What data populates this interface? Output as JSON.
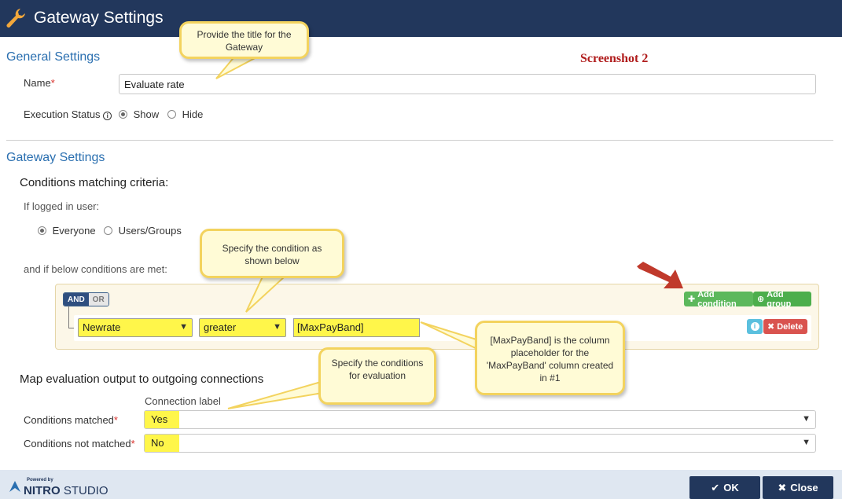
{
  "window": {
    "title": "Gateway Settings",
    "icon": "wrench-icon"
  },
  "annotation_label": "Screenshot 2",
  "general": {
    "section_title": "General Settings",
    "name_label": "Name",
    "name_value": "Evaluate rate",
    "execution_status_label": "Execution Status",
    "execution_options": [
      "Show",
      "Hide"
    ],
    "execution_selected": "Show"
  },
  "gateway": {
    "section_title": "Gateway Settings",
    "criteria_title": "Conditions matching criteria:",
    "logged_in_label": "If logged in user:",
    "user_options": [
      "Everyone",
      "Users/Groups"
    ],
    "user_selected": "Everyone",
    "conditions_met_label": "and if below conditions are met:",
    "logic": {
      "and": "AND",
      "or": "OR",
      "selected": "AND"
    },
    "add_condition": "Add condition",
    "add_group": "Add group",
    "rule": {
      "field": "Newrate",
      "operator": "greater",
      "value": "[MaxPayBand]"
    },
    "delete_label": "Delete"
  },
  "mapping": {
    "title": "Map evaluation output to outgoing connections",
    "connection_label_header": "Connection label",
    "rows": [
      {
        "label": "Conditions matched",
        "value": "Yes"
      },
      {
        "label": "Conditions not matched",
        "value": "No"
      }
    ]
  },
  "callouts": {
    "title_tip": "Provide the title for the Gateway",
    "condition_tip": "Specify the condition as shown below",
    "evaluation_tip": "Specify the conditions for evaluation",
    "placeholder_tip": "[MaxPayBand] is the column placeholder for the 'MaxPayBand' column created in #1"
  },
  "footer": {
    "powered_by": "Powered by",
    "brand_bold": "NITRO",
    "brand_rest": " STUDIO",
    "ok": "OK",
    "close": "Close"
  },
  "colors": {
    "header": "#22375c",
    "highlight": "#fff64a",
    "arrow": "#c0392b"
  }
}
